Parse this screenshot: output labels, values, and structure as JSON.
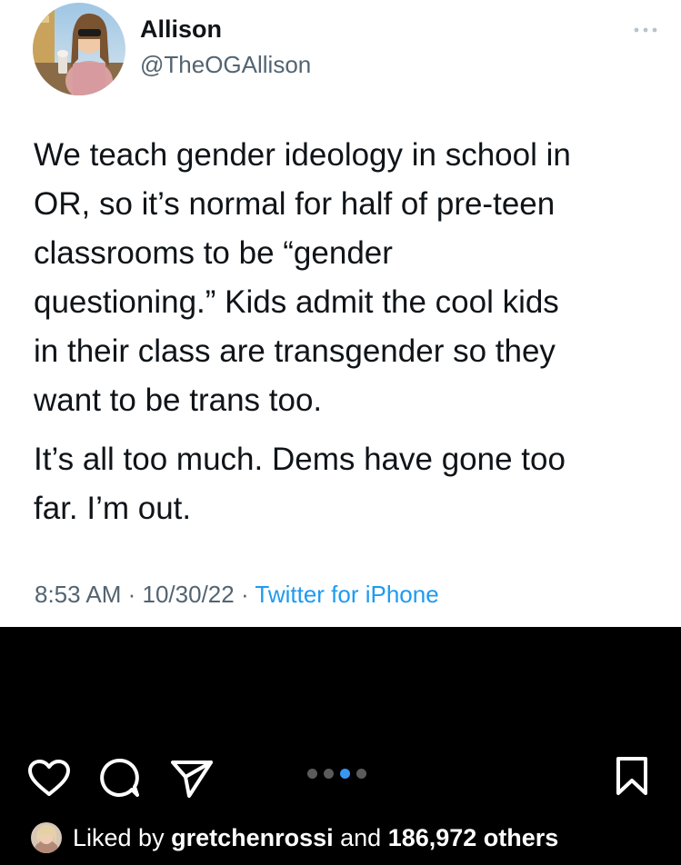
{
  "tweet": {
    "display_name": "Allison",
    "handle": "@TheOGAllison",
    "paragraphs": [
      "We teach gender ideology in school in\nOR, so it’s normal for half of pre-teen\nclassrooms to be “gender\nquestioning.” Kids admit the cool kids\nin their class are transgender so they\nwant to be trans too.",
      "It’s all too much. Dems have gone too\nfar. I’m out."
    ],
    "time": "8:53 AM",
    "separator": " · ",
    "date": "10/30/22",
    "source": "Twitter for iPhone",
    "more_icon": "more-horizontal-icon"
  },
  "instagram": {
    "icons": [
      "heart-icon",
      "comment-icon",
      "share-icon",
      "bookmark-icon"
    ],
    "carousel": {
      "count": 4,
      "active_index": 2
    },
    "likes": {
      "prefix": "Liked by ",
      "user": "gretchenrossi",
      "middle": " and ",
      "count": "186,972 others"
    }
  },
  "colors": {
    "text_primary": "#0f1419",
    "text_secondary": "#536471",
    "link": "#1d9bf0",
    "ig_background": "#000000",
    "ig_active_dot": "#3897f0",
    "ig_dot": "#5b5b5b"
  }
}
